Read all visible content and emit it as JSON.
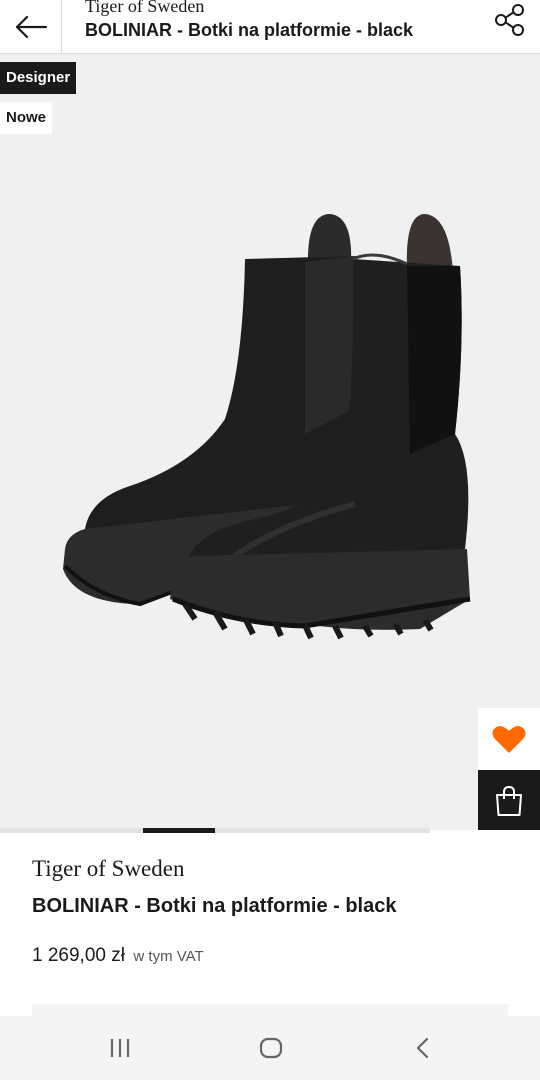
{
  "header": {
    "brand": "Tiger of Sweden",
    "title": "BOLINIAR - Botki na platformie - black"
  },
  "badges": {
    "designer": "Designer",
    "new": "Nowe"
  },
  "product": {
    "brand": "Tiger of Sweden",
    "title": "BOLINIAR - Botki na platformie - black",
    "price": "1 269,00 zł",
    "vat_note": "w tym VAT"
  },
  "carousel": {
    "active_index": 2
  },
  "icons": {
    "back": "arrow-left-icon",
    "share": "share-icon",
    "favorite": "heart-icon",
    "bag": "shopping-bag-icon"
  },
  "colors": {
    "accent": "#ff6900",
    "dark": "#1a1a1a",
    "image_bg": "#f0f0f0"
  }
}
